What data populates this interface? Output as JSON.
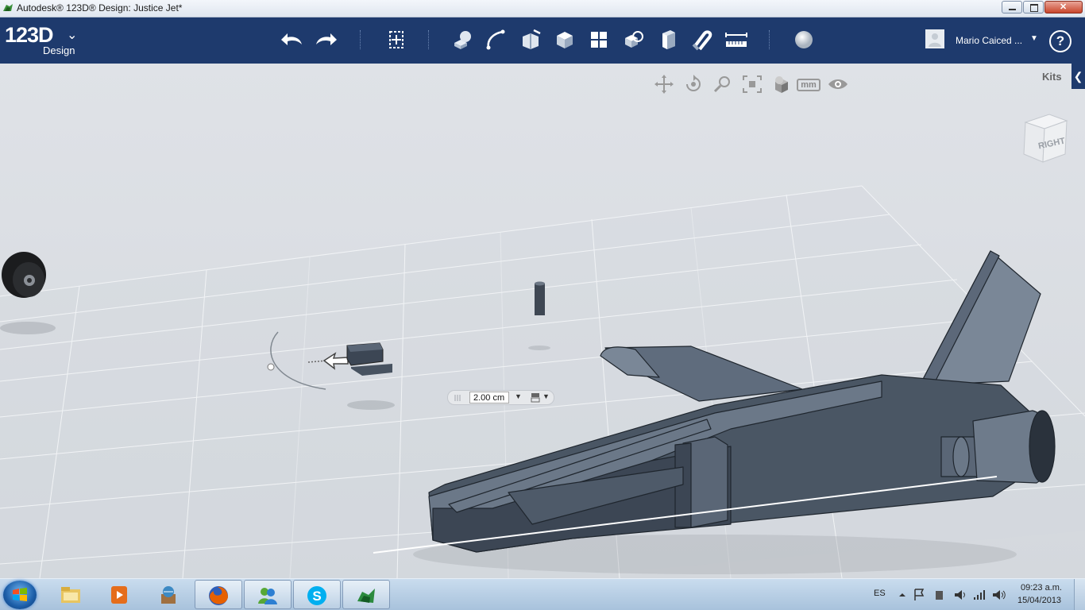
{
  "window": {
    "title": "Autodesk® 123D® Design: Justice Jet*"
  },
  "toolbar": {
    "logo_number": "123D",
    "logo_subtitle": "Design",
    "logo_menu_icon": "chevron-down-icon",
    "tools": [
      "undo-icon",
      "redo-icon",
      "transform-icon",
      "primitives-icon",
      "sketch-icon",
      "construct-icon",
      "modify-icon",
      "pattern-icon",
      "grouping-icon",
      "combine-icon",
      "snap-icon",
      "measure-icon",
      "material-icon"
    ],
    "user_name": "Mario Caiced ...",
    "help_label": "?"
  },
  "viewport": {
    "kits_label": "Kits",
    "kits_tab_glyph": "❮",
    "nav_tools": [
      "pan-icon",
      "orbit-icon",
      "zoom-icon",
      "fit-icon",
      "view-mode-icon",
      "units-icon",
      "visibility-icon"
    ],
    "units_label": "mm",
    "viewcube_face": "RIGHT",
    "dimension_value": "2.00 cm",
    "accent_color": "#1e3a6d"
  },
  "taskbar": {
    "apps": [
      "windows-explorer-icon",
      "media-player-icon",
      "control-panel-icon",
      "firefox-icon",
      "messenger-icon",
      "skype-icon",
      "123d-design-icon"
    ],
    "language": "ES",
    "time": "09:23 a.m.",
    "date": "15/04/2013"
  }
}
